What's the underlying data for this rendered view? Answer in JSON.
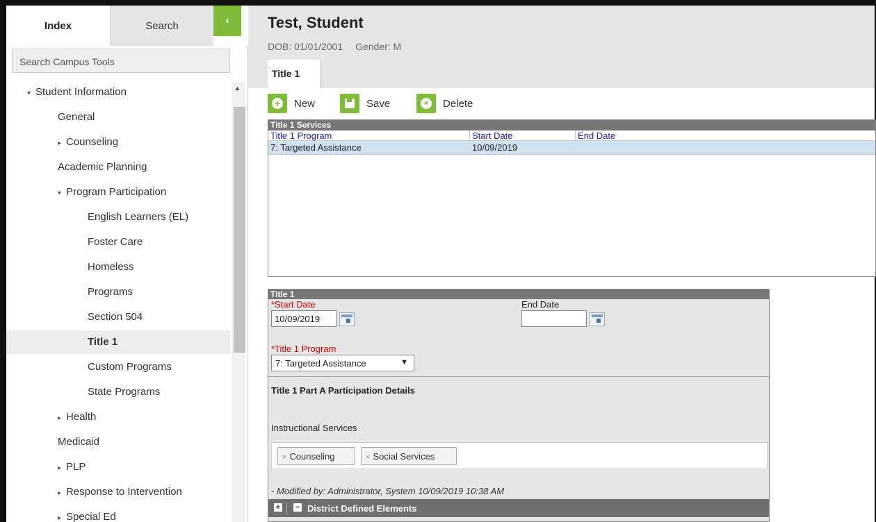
{
  "sidebar": {
    "tab_index": "Index",
    "tab_search": "Search",
    "collapse_glyph": "‹",
    "search_placeholder": "Search Campus Tools",
    "tree": [
      {
        "label": "Student Information",
        "tri": "▾"
      },
      {
        "label": "General",
        "tri": ""
      },
      {
        "label": "Counseling",
        "tri": "▸"
      },
      {
        "label": "Academic Planning",
        "tri": ""
      },
      {
        "label": "Program Participation",
        "tri": "▾"
      },
      {
        "label": "English Learners (EL)",
        "tri": ""
      },
      {
        "label": "Foster Care",
        "tri": ""
      },
      {
        "label": "Homeless",
        "tri": ""
      },
      {
        "label": "Programs",
        "tri": ""
      },
      {
        "label": "Section 504",
        "tri": ""
      },
      {
        "label": "Title 1",
        "tri": "",
        "selected": true
      },
      {
        "label": "Custom Programs",
        "tri": ""
      },
      {
        "label": "State Programs",
        "tri": ""
      },
      {
        "label": "Health",
        "tri": "▸"
      },
      {
        "label": "Medicaid",
        "tri": ""
      },
      {
        "label": "PLP",
        "tri": "▸"
      },
      {
        "label": "Response to Intervention",
        "tri": "▸"
      },
      {
        "label": "Special Ed",
        "tri": "▸"
      }
    ]
  },
  "header": {
    "student_name": "Test, Student",
    "dob": "DOB: 01/01/2001",
    "gender": "Gender: M"
  },
  "tab": {
    "label": "Title 1"
  },
  "toolbar": {
    "new_label": "New",
    "save_label": "Save",
    "delete_label": "Delete"
  },
  "services": {
    "title": "Title 1 Services",
    "columns": [
      "Title 1 Program",
      "Start Date",
      "End Date"
    ],
    "rows": [
      {
        "program": "7: Targeted Assistance",
        "start": "10/09/2019",
        "end": ""
      }
    ]
  },
  "detail": {
    "title": "Title 1",
    "start_date_label": "*Start Date",
    "start_date_value": "10/09/2019",
    "end_date_label": "End Date",
    "end_date_value": "",
    "program_label": "*Title 1 Program",
    "program_value": "7: Targeted Assistance",
    "program_arrow": "▼",
    "participation_heading": "Title 1 Part A Participation Details",
    "instructional_label": "Instructional Services",
    "chips": [
      "Counseling",
      "Social Services"
    ],
    "chip_remove": "×",
    "modified": "- Modified by: Administrator, System 10/09/2019 10:38 AM",
    "district_label": "District Defined Elements",
    "expand_glyph": "+",
    "collapse_glyph": "−"
  },
  "colors": {
    "accent_green": "#7ebc3a",
    "header_gray": "#e6e6e6",
    "section_head": "#777777",
    "link_blue": "#2020c0",
    "required_red": "#e00000",
    "row_selected": "#cfe0ef"
  }
}
